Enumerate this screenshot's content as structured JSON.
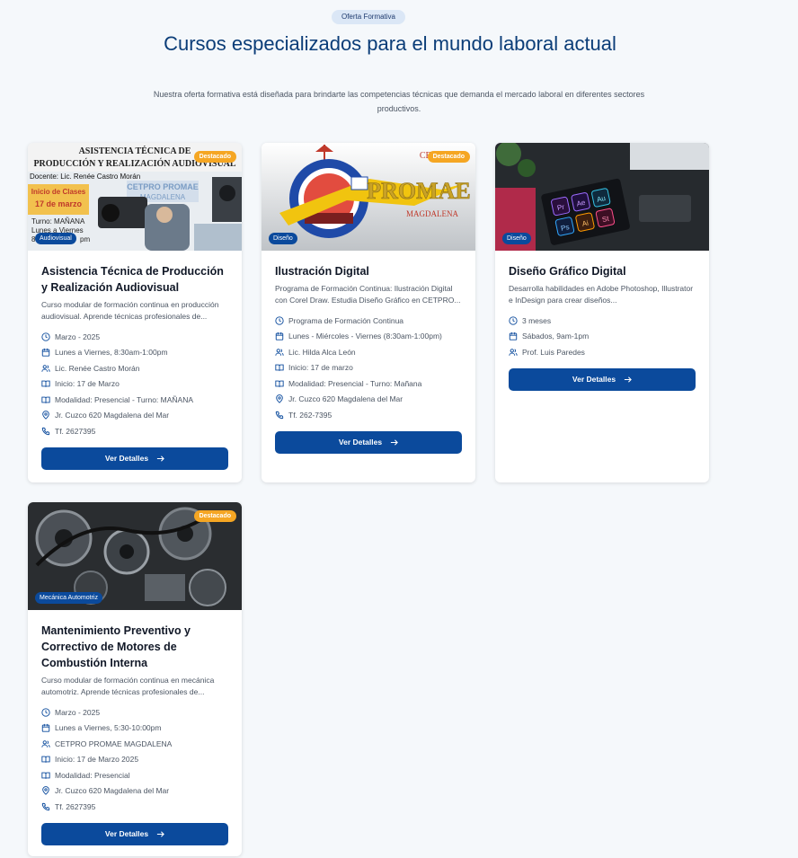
{
  "header": {
    "badge": "Oferta Formativa",
    "title": "Cursos especializados para el mundo laboral actual",
    "subtitle": "Nuestra oferta formativa está diseñada para brindarte las competencias técnicas que demanda el mercado laboral en diferentes sectores productivos."
  },
  "colors": {
    "primary": "#0b4a9c",
    "accent": "#f5a623",
    "title": "#0b3d78",
    "background": "#f5f8fb"
  },
  "cards": [
    {
      "featured": "Destacado",
      "category": "Audiovisual",
      "image_text": [
        "ASISTENCIA TÉCNICA DE",
        "PRODUCCIÓN Y REALIZACIÓN AUDIOVISUAL",
        "Docente: Lic. Renée Castro Morán",
        "CETPRO PROMAE",
        "MAGDALENA",
        "Inicio de Clases",
        "17 de marzo",
        "Turno: MAÑANA",
        "Lunes a Viernes",
        "8",
        "pm"
      ],
      "title": "Asistencia Técnica de Producción y Realización Audiovisual",
      "description": "Curso modular de formación continua en producción audiovisual. Aprende técnicas profesionales de...",
      "info": [
        {
          "icon": "clock-icon",
          "text": "Marzo - 2025"
        },
        {
          "icon": "calendar-icon",
          "text": "Lunes a Viernes, 8:30am-1:00pm"
        },
        {
          "icon": "users-icon",
          "text": "Lic. Renée Castro Morán"
        },
        {
          "icon": "book-icon",
          "text": "Inicio: 17 de Marzo"
        },
        {
          "icon": "book-icon",
          "text": "Modalidad: Presencial - Turno: MAÑANA"
        },
        {
          "icon": "map-pin-icon",
          "text": "Jr. Cuzco 620 Magdalena del Mar"
        },
        {
          "icon": "phone-icon",
          "text": "Tf. 2627395"
        }
      ],
      "button": "Ver Detalles"
    },
    {
      "featured": "Destacado",
      "category": "Diseño",
      "image_text": [
        "CETPRO",
        "PROMAE",
        "MAGDALENA"
      ],
      "title": "Ilustración Digital",
      "description": "Programa de Formación Continua: Ilustración Digital con Corel Draw. Estudia Diseño Gráfico en CETPRO...",
      "info": [
        {
          "icon": "clock-icon",
          "text": "Programa de Formación Continua"
        },
        {
          "icon": "calendar-icon",
          "text": "Lunes - Miércoles - Viernes (8:30am-1:00pm)"
        },
        {
          "icon": "users-icon",
          "text": "Lic. Hilda Alca León"
        },
        {
          "icon": "book-icon",
          "text": "Inicio: 17 de marzo"
        },
        {
          "icon": "book-icon",
          "text": "Modalidad: Presencial - Turno: Mañana"
        },
        {
          "icon": "map-pin-icon",
          "text": "Jr. Cuzco 620 Magdalena del Mar"
        },
        {
          "icon": "phone-icon",
          "text": "Tf. 262-7395"
        }
      ],
      "button": "Ver Detalles"
    },
    {
      "featured": "",
      "category": "Diseño",
      "image_text": [
        "Pr",
        "Ae",
        "Au",
        "Ps",
        "Ai",
        "St"
      ],
      "title": "Diseño Gráfico Digital",
      "description": "Desarrolla habilidades en Adobe Photoshop, Illustrator e InDesign para crear diseños...",
      "info": [
        {
          "icon": "clock-icon",
          "text": "3 meses"
        },
        {
          "icon": "calendar-icon",
          "text": "Sábados, 9am-1pm"
        },
        {
          "icon": "users-icon",
          "text": "Prof. Luis Paredes"
        }
      ],
      "button": "Ver Detalles"
    },
    {
      "featured": "Destacado",
      "category": "Mecánica Automotriz",
      "image_text": [],
      "title": "Mantenimiento Preventivo y Correctivo de Motores de Combustión Interna",
      "description": "Curso modular de formación continua en mecánica automotriz. Aprende técnicas profesionales de...",
      "info": [
        {
          "icon": "clock-icon",
          "text": "Marzo - 2025"
        },
        {
          "icon": "calendar-icon",
          "text": "Lunes a Viernes, 5:30-10:00pm"
        },
        {
          "icon": "users-icon",
          "text": "CETPRO PROMAE MAGDALENA"
        },
        {
          "icon": "book-icon",
          "text": "Inicio: 17 de Marzo 2025"
        },
        {
          "icon": "book-icon",
          "text": "Modalidad: Presencial"
        },
        {
          "icon": "map-pin-icon",
          "text": "Jr. Cuzco 620 Magdalena del Mar"
        },
        {
          "icon": "phone-icon",
          "text": "Tf. 2627395"
        }
      ],
      "button": "Ver Detalles"
    }
  ]
}
